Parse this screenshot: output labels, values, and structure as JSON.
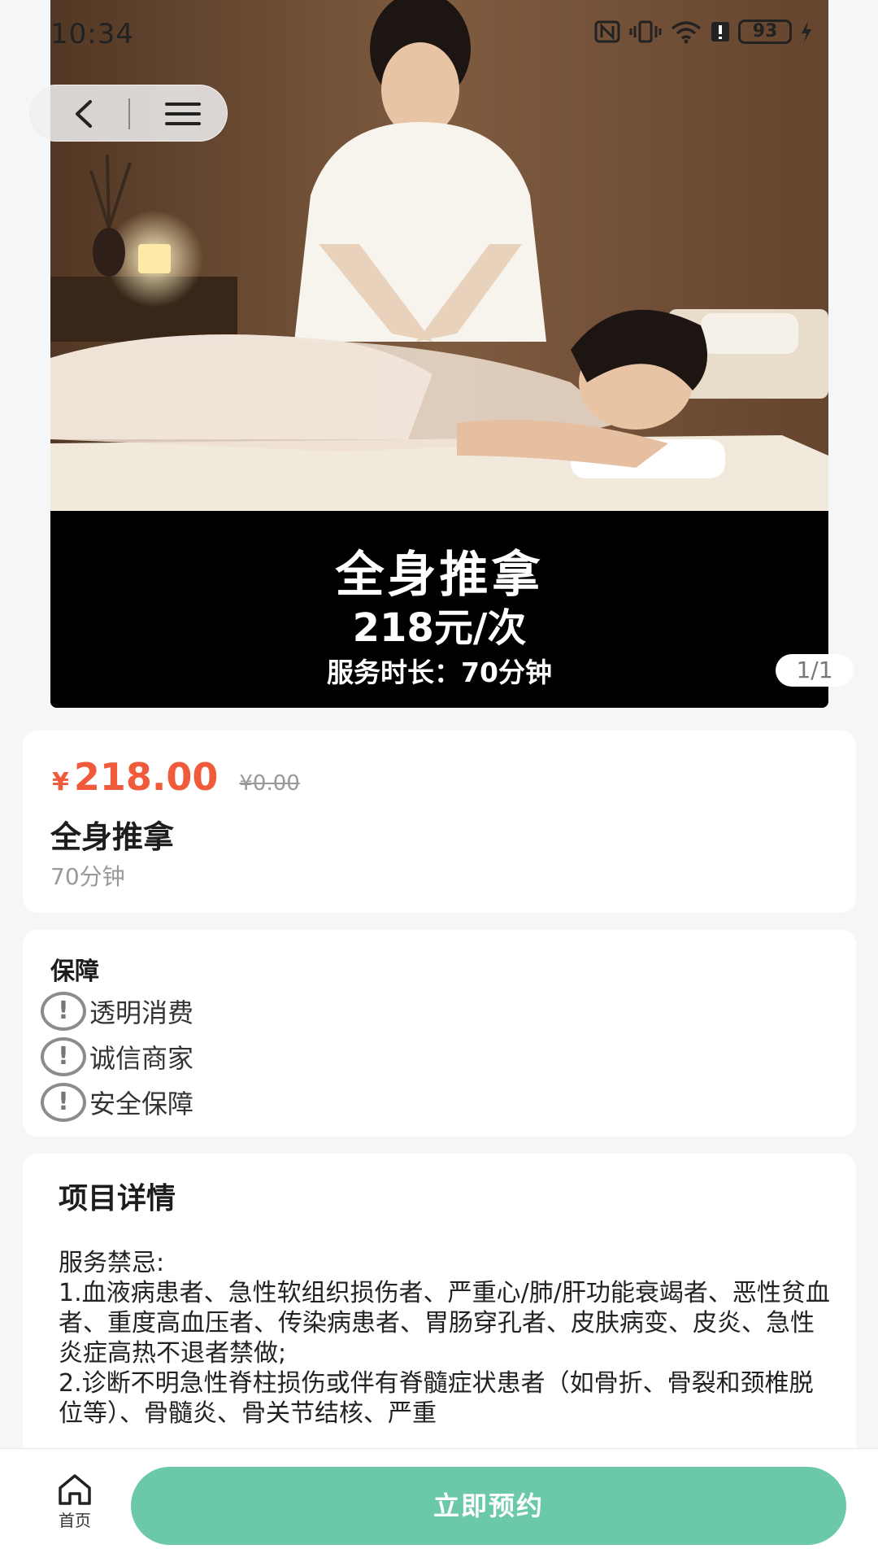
{
  "status_bar": {
    "time": "10:34",
    "battery": "93"
  },
  "hero": {
    "title": "全身推拿",
    "price_text": "218元/次",
    "duration_text": "服务时长：70分钟",
    "page_indicator": "1/1"
  },
  "product": {
    "currency": "¥",
    "price": "218.00",
    "original_price": "¥0.00",
    "name": "全身推拿",
    "duration": "70分钟",
    "price_color": "#ef5b3b"
  },
  "guarantee": {
    "title": "保障",
    "items": [
      {
        "icon": "exclamation-circle-icon",
        "label": "透明消费"
      },
      {
        "icon": "exclamation-circle-icon",
        "label": "诚信商家"
      },
      {
        "icon": "exclamation-circle-icon",
        "label": "安全保障"
      }
    ]
  },
  "details": {
    "title": "项目详情",
    "lines": [
      "服务禁忌:",
      "1.血液病患者、急性软组织损伤者、严重心/肺/肝功能衰竭者、恶性贫血者、重度高血压者、传染病患者、胃肠穿孔者、皮肤病变、皮炎、急性炎症高热不退者禁做;",
      "2.诊断不明急性脊柱损伤或伴有脊髓症状患者（如骨折、骨裂和颈椎脱位等）、骨髓炎、骨关节结核、严重"
    ]
  },
  "bottom_bar": {
    "home_label": "首页",
    "book_label": "立即预约",
    "accent_color": "#6cc9a7"
  }
}
